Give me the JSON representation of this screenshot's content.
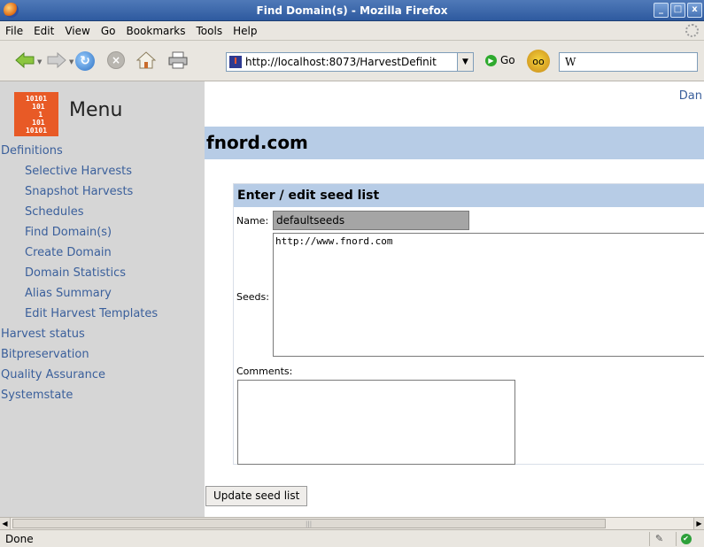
{
  "window": {
    "title": "Find Domain(s) - Mozilla Firefox",
    "controls": [
      "_",
      "□",
      "x"
    ]
  },
  "menubar": {
    "items": [
      "File",
      "Edit",
      "View",
      "Go",
      "Bookmarks",
      "Tools",
      "Help"
    ]
  },
  "toolbar": {
    "url": "http://localhost:8073/HarvestDefinit",
    "go_label": "Go",
    "search_value": "W"
  },
  "sidebar": {
    "logo_text": "10101\n 101\n  1\n 101\n10101",
    "menu_title": "Menu",
    "links": [
      {
        "label": "Definitions",
        "level": "top"
      },
      {
        "label": "Selective Harvests",
        "level": "sub"
      },
      {
        "label": "Snapshot Harvests",
        "level": "sub"
      },
      {
        "label": "Schedules",
        "level": "sub"
      },
      {
        "label": "Find Domain(s)",
        "level": "sub"
      },
      {
        "label": "Create Domain",
        "level": "sub"
      },
      {
        "label": "Domain Statistics",
        "level": "sub"
      },
      {
        "label": "Alias Summary",
        "level": "sub"
      },
      {
        "label": "Edit Harvest Templates",
        "level": "sub"
      },
      {
        "label": "Harvest status",
        "level": "top"
      },
      {
        "label": "Bitpreservation",
        "level": "top"
      },
      {
        "label": "Quality Assurance",
        "level": "top"
      },
      {
        "label": "Systemstate",
        "level": "top"
      }
    ]
  },
  "header": {
    "language_link": "Dan"
  },
  "main": {
    "domain_title": "fnord.com",
    "seed_list": {
      "heading": "Enter / edit seed list",
      "name_label": "Name:",
      "name_value": "defaultseeds",
      "seeds_label": "Seeds:",
      "seeds_value": "http://www.fnord.com",
      "comments_label": "Comments:",
      "comments_value": ""
    },
    "update_button": "Update seed list"
  },
  "statusbar": {
    "text": "Done"
  }
}
